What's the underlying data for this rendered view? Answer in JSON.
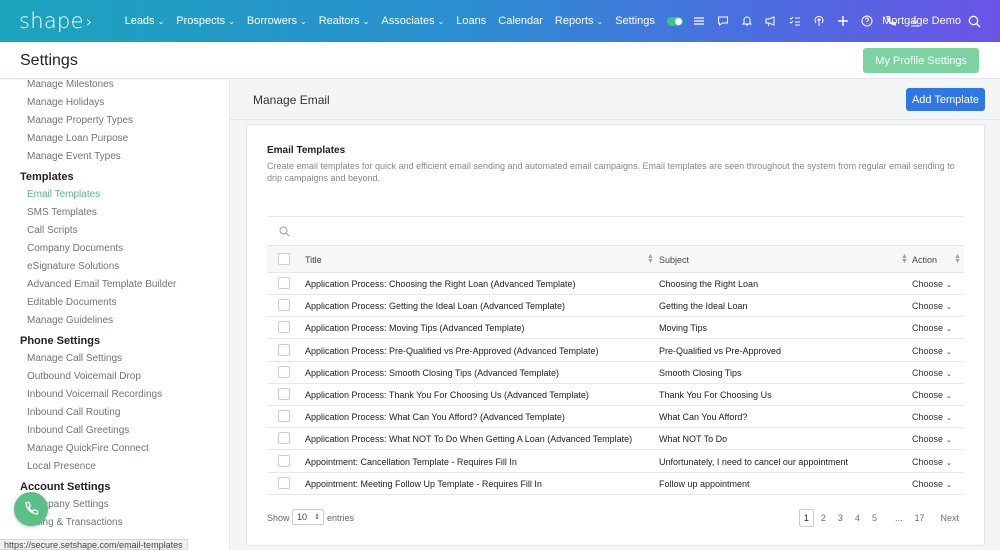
{
  "app": {
    "logo_text": "shape",
    "logo_chevron": "›"
  },
  "nav": {
    "links": [
      {
        "label": "Leads",
        "caret": true
      },
      {
        "label": "Prospects",
        "caret": true
      },
      {
        "label": "Borrowers",
        "caret": true
      },
      {
        "label": "Realtors",
        "caret": true
      },
      {
        "label": "Associates",
        "caret": true
      },
      {
        "label": "Loans",
        "caret": false
      },
      {
        "label": "Calendar",
        "caret": false
      },
      {
        "label": "Reports",
        "caret": true
      },
      {
        "label": "Settings",
        "caret": false
      }
    ],
    "icons": [
      "toggle-icon",
      "list-icon",
      "chat-icon",
      "bell-icon",
      "megaphone-icon",
      "checklist-icon",
      "podcast-icon",
      "plus-icon",
      "help-icon",
      "phone-icon",
      "download-icon"
    ],
    "user_name": "Mortgage Demo"
  },
  "header": {
    "title": "Settings",
    "profile_button": "My Profile Settings"
  },
  "sidebar": {
    "items_top": [
      "Manage Milestones",
      "Manage Holidays",
      "Manage Property Types",
      "Manage Loan Purpose",
      "Manage Event Types"
    ],
    "templates_heading": "Templates",
    "templates_items": [
      "Email Templates",
      "SMS Templates",
      "Call Scripts",
      "Company Documents",
      "eSignature Solutions",
      "Advanced Email Template Builder",
      "Editable Documents",
      "Manage Guidelines"
    ],
    "phone_heading": "Phone Settings",
    "phone_items": [
      "Manage Call Settings",
      "Outbound Voicemail Drop",
      "Inbound Voicemail Recordings",
      "Inbound Call Routing",
      "Inbound Call Greetings",
      "Manage QuickFire Connect",
      "Local Presence"
    ],
    "account_heading": "Account Settings",
    "account_items": [
      "Company Settings",
      "Billing & Transactions"
    ],
    "active_item": "Email Templates"
  },
  "main": {
    "title": "Manage Email",
    "add_button": "Add Template",
    "card_title": "Email Templates",
    "card_desc": "Create email templates for quick and efficient email sending and automated email campaigns. Email templates are seen throughout the system from regular email sending to drip campaigns and beyond.",
    "table": {
      "columns": [
        "Title",
        "Subject",
        "Action"
      ],
      "rows": [
        {
          "title": "Application Process: Choosing the Right Loan (Advanced Template)",
          "subject": "Choosing the Right Loan",
          "action": "Choose"
        },
        {
          "title": "Application Process: Getting the Ideal Loan (Advanced Template)",
          "subject": "Getting the Ideal Loan",
          "action": "Choose"
        },
        {
          "title": "Application Process: Moving Tips (Advanced Template)",
          "subject": "Moving Tips",
          "action": "Choose"
        },
        {
          "title": "Application Process: Pre-Qualified vs Pre-Approved (Advanced Template)",
          "subject": "Pre-Qualified vs Pre-Approved",
          "action": "Choose"
        },
        {
          "title": "Application Process: Smooth Closing Tips (Advanced Template)",
          "subject": "Smooth Closing Tips",
          "action": "Choose"
        },
        {
          "title": "Application Process: Thank You For Choosing Us (Advanced Template)",
          "subject": "Thank You For Choosing Us",
          "action": "Choose"
        },
        {
          "title": "Application Process: What Can You Afford? (Advanced Template)",
          "subject": "What Can You Afford?",
          "action": "Choose"
        },
        {
          "title": "Application Process: What NOT To Do When Getting A Loan (Advanced Template)",
          "subject": "What NOT To Do",
          "action": "Choose"
        },
        {
          "title": "Appointment: Cancellation Template - Requires Fill In",
          "subject": "Unfortunately, I need to cancel our appointment",
          "action": "Choose"
        },
        {
          "title": "Appointment: Meeting Follow Up Template - Requires Fill In",
          "subject": "Follow up appointment",
          "action": "Choose"
        }
      ]
    },
    "footer": {
      "show_label": "Show",
      "page_size": "10",
      "entries_label": "entries",
      "pages": [
        "1",
        "2",
        "3",
        "4",
        "5",
        "...",
        "17"
      ],
      "current_page": "1",
      "next_label": "Next"
    }
  },
  "status_url": "https://secure.setshape.com/email-templates",
  "colors": {
    "accent_green": "#5cb87d",
    "button_blue": "#2e77e5",
    "profile_green": "#7bd3a2"
  }
}
